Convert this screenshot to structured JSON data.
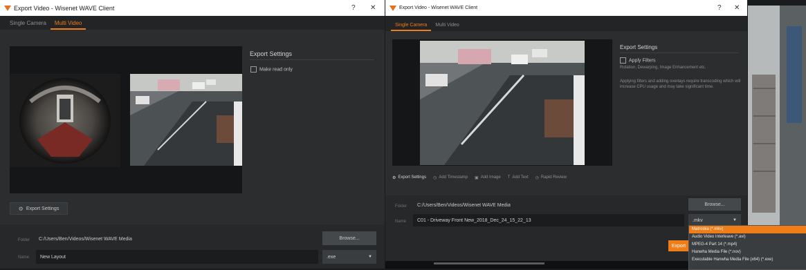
{
  "left": {
    "title": "Export Video - Wisenet WAVE Client",
    "help": "?",
    "close": "✕",
    "tabs": [
      "Single Camera",
      "Multi Video"
    ],
    "active_tab": 1,
    "settings_title": "Export Settings",
    "make_readonly": "Make read only",
    "export_settings_button": "Export Settings",
    "folder_label": "Folder",
    "folder_value": "C:/Users/Ben/Videos/Wisenet WAVE Media",
    "browse": "Browse...",
    "name_label": "Name",
    "name_value": "New Layout",
    "format": ".exe"
  },
  "right": {
    "title": "Export Video - Wisenet WAVE Client",
    "help": "?",
    "close": "✕",
    "tabs": [
      "Single Camera",
      "Multi Video"
    ],
    "active_tab": 0,
    "settings_title": "Export Settings",
    "apply_filters": "Apply Filters",
    "filters_desc": "Rotation, Dewarping, Image Enhancement etc.",
    "warning": "Applying filters and adding overlays require transcoding which will increase CPU usage and may take significant time.",
    "options": [
      "Export Settings",
      "Add Timestamp",
      "Add Image",
      "Add Text",
      "Rapid Review"
    ],
    "folder_label": "Folder",
    "folder_value": "C:/Users/Ben/Videos/Wisenet WAVE Media",
    "browse": "Browse...",
    "name_label": "Name",
    "name_value": "C01 - Driveway Front New_2018_Dec_24_15_22_13",
    "format": ".mkv",
    "export_btn": "Export",
    "dropdown": [
      "Matroska (*.mkv)",
      "Audio Video Interleave (*.avi)",
      "MPEG-4 Part 14 (*.mp4)",
      "Hanwha Media File (*.nov)",
      "Executable Hanwha Media File (x64) (*.exe)"
    ],
    "dropdown_selected": 0,
    "colors": {
      "accent": "#f07d18"
    }
  }
}
